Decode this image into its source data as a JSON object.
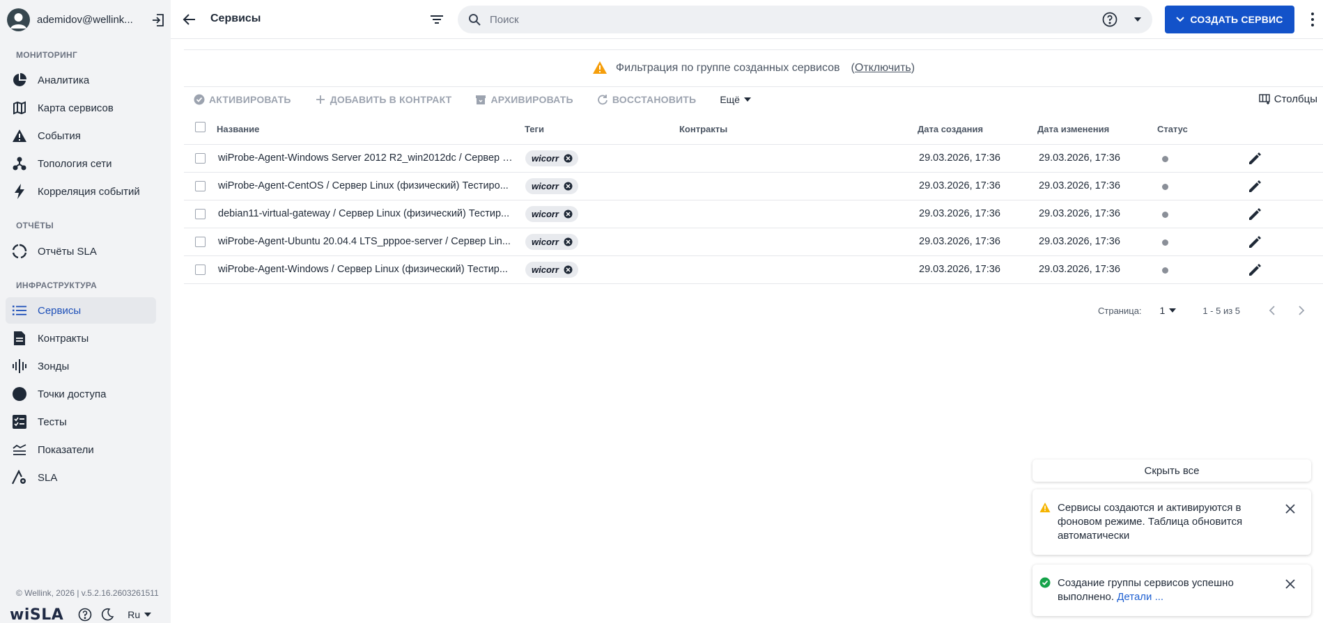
{
  "sidebar": {
    "user": {
      "name": "ademidov@wellink..."
    },
    "sections": {
      "monitoring": "МОНИТОРИНГ",
      "reports": "ОТЧЁТЫ",
      "infrastructure": "ИНФРАСТРУКТУРА"
    },
    "items": [
      {
        "label": "Аналитика",
        "icon": "pie-chart-icon"
      },
      {
        "label": "Карта сервисов",
        "icon": "map-icon"
      },
      {
        "label": "События",
        "icon": "warning-icon"
      },
      {
        "label": "Топология сети",
        "icon": "topology-icon"
      },
      {
        "label": "Корреляция событий",
        "icon": "lightning-icon"
      },
      {
        "label": "Отчёты SLA",
        "icon": "sla-report-icon"
      },
      {
        "label": "Сервисы",
        "icon": "list-icon",
        "active": true
      },
      {
        "label": "Контракты",
        "icon": "document-icon"
      },
      {
        "label": "Зонды",
        "icon": "probe-icon"
      },
      {
        "label": "Точки доступа",
        "icon": "circle-icon"
      },
      {
        "label": "Тесты",
        "icon": "checklist-icon"
      },
      {
        "label": "Показатели",
        "icon": "metrics-icon"
      },
      {
        "label": "SLA",
        "icon": "sla-gear-icon"
      }
    ],
    "footer": {
      "version": "© Wellink, 2026 | v.5.2.16.2603261511",
      "logo": "wiSLA",
      "language": "Ru"
    }
  },
  "header": {
    "title": "Сервисы",
    "search_placeholder": "Поиск",
    "create_button": "СОЗДАТЬ СЕРВИС"
  },
  "banner": {
    "text": "Фильтрация по группе созданных сервисов",
    "link": "Отключить"
  },
  "toolbar": {
    "activate": "АКТИВИРОВАТЬ",
    "add_to_contract": "ДОБАВИТЬ В КОНТРАКТ",
    "archive": "АРХИВИРОВАТЬ",
    "restore": "ВОССТАНОВИТЬ",
    "more": "Ещё",
    "columns": "Столбцы"
  },
  "table": {
    "headers": {
      "name": "Название",
      "tags": "Теги",
      "contracts": "Контракты",
      "created": "Дата создания",
      "modified": "Дата изменения",
      "status": "Статус"
    },
    "rows": [
      {
        "name": "wiProbe-Agent-Windows Server 2012 R2_win2012dc / Сервер L...",
        "tag": "wicorr",
        "contracts": "",
        "created": "29.03.2026, 17:36",
        "modified": "29.03.2026, 17:36"
      },
      {
        "name": "wiProbe-Agent-CentOS / Сервер Linux (физический) Тестиро...",
        "tag": "wicorr",
        "contracts": "",
        "created": "29.03.2026, 17:36",
        "modified": "29.03.2026, 17:36"
      },
      {
        "name": "debian11-virtual-gateway / Сервер Linux (физический) Тестир...",
        "tag": "wicorr",
        "contracts": "",
        "created": "29.03.2026, 17:36",
        "modified": "29.03.2026, 17:36"
      },
      {
        "name": "wiProbe-Agent-Ubuntu 20.04.4 LTS_pppoe-server / Сервер Lin...",
        "tag": "wicorr",
        "contracts": "",
        "created": "29.03.2026, 17:36",
        "modified": "29.03.2026, 17:36"
      },
      {
        "name": "wiProbe-Agent-Windows / Сервер Linux (физический) Тестир...",
        "tag": "wicorr",
        "contracts": "",
        "created": "29.03.2026, 17:36",
        "modified": "29.03.2026, 17:36"
      }
    ]
  },
  "pagination": {
    "page_label": "Страница:",
    "page": "1",
    "range": "1 - 5 из 5"
  },
  "notifications": {
    "hide_all": "Скрыть все",
    "warning_text": "Сервисы создаются и активируются в фоновом режиме. Таблица обновится автоматически",
    "success_text": "Создание группы сервисов успешно выполнено.",
    "success_link": "Детали ..."
  },
  "colors": {
    "primary": "#1352c9",
    "warning": "#f59e0b",
    "success": "#16a34a",
    "sidebar_bg": "#f2f3f5"
  }
}
